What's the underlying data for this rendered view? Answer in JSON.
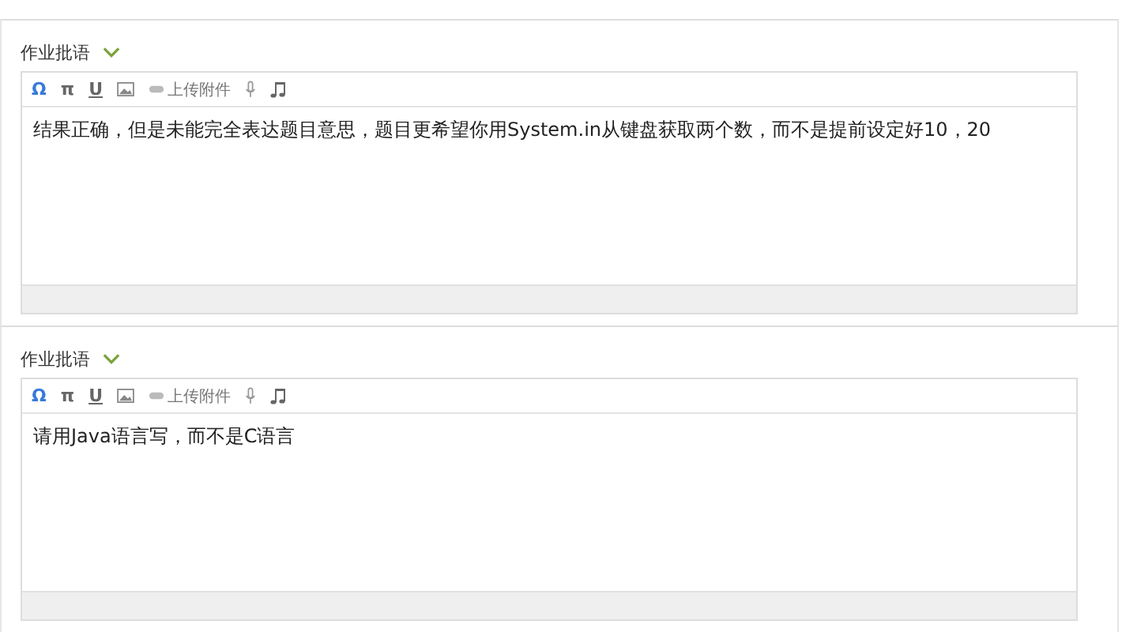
{
  "comments": [
    {
      "label": "作业批语",
      "expanded": true,
      "toolbar": [
        {
          "kind": "symbol",
          "text": "Ω",
          "highlighted": true
        },
        {
          "kind": "symbol",
          "text": "π",
          "highlighted": false
        },
        {
          "kind": "underline",
          "text": "U",
          "highlighted": false
        },
        {
          "kind": "image"
        },
        {
          "kind": "attach",
          "text": "上传附件"
        },
        {
          "kind": "mic"
        },
        {
          "kind": "music"
        }
      ],
      "value": "结果正确，但是未能完全表达题目意思，题目更希望你用System.in从键盘获取两个数，而不是提前设定好10，20"
    },
    {
      "label": "作业批语",
      "expanded": true,
      "toolbar": [
        {
          "kind": "symbol",
          "text": "Ω",
          "highlighted": true
        },
        {
          "kind": "symbol",
          "text": "π",
          "highlighted": false
        },
        {
          "kind": "underline",
          "text": "U",
          "highlighted": false
        },
        {
          "kind": "image"
        },
        {
          "kind": "attach",
          "text": "上传附件"
        },
        {
          "kind": "mic"
        },
        {
          "kind": "music"
        }
      ],
      "value": "请用Java语言写，而不是C语言"
    }
  ]
}
